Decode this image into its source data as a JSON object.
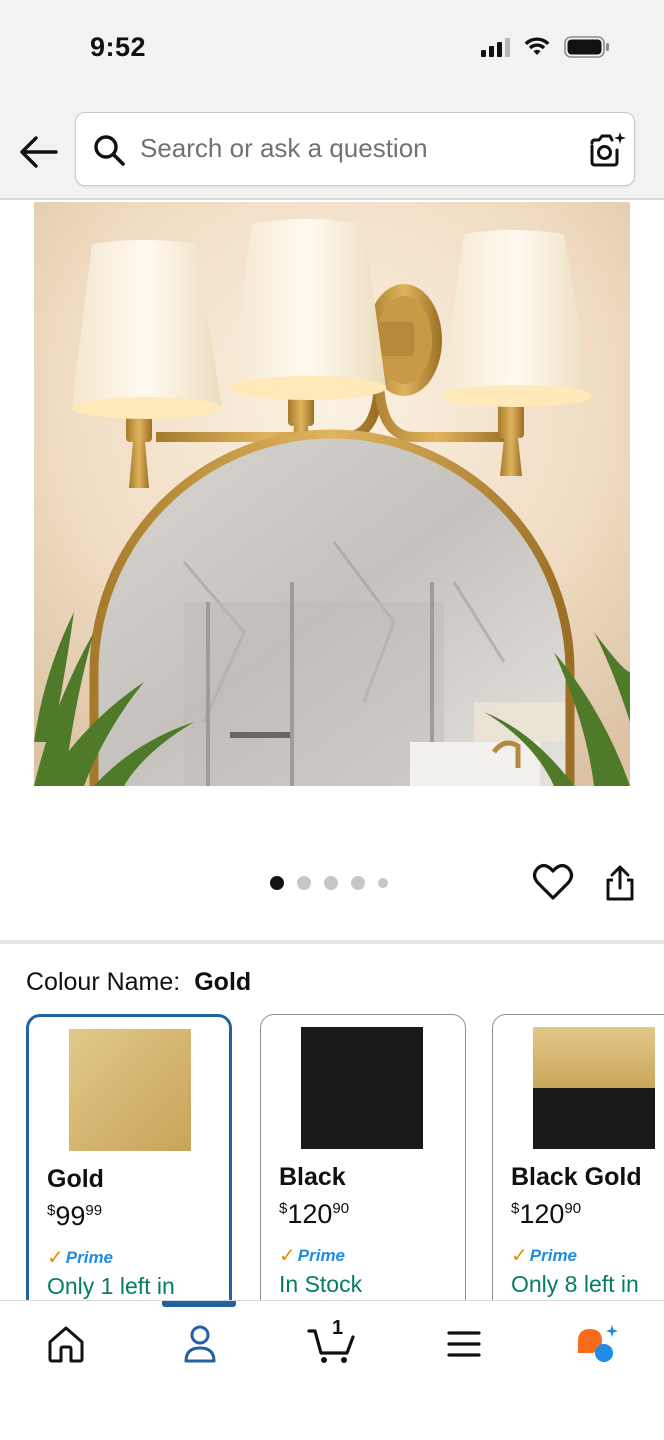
{
  "status_bar": {
    "time": "9:52"
  },
  "search": {
    "placeholder": "Search or ask a question"
  },
  "carousel": {
    "total_images": 5,
    "active_index": 0
  },
  "variation": {
    "label": "Colour Name:",
    "selected_value": "Gold",
    "options": [
      {
        "name": "Gold",
        "price_currency": "$",
        "price_whole": "99",
        "price_cents": "99",
        "prime_label": "Prime",
        "availability": "Only 1 left in",
        "swatch_colors": [
          "#d9bd79",
          "#c9a75a"
        ],
        "selected": true
      },
      {
        "name": "Black",
        "price_currency": "$",
        "price_whole": "120",
        "price_cents": "90",
        "prime_label": "Prime",
        "availability": "In Stock",
        "swatch_colors": [
          "#1a1a1a",
          "#1a1a1a"
        ],
        "selected": false
      },
      {
        "name": "Black Gold",
        "price_currency": "$",
        "price_whole": "120",
        "price_cents": "90",
        "prime_label": "Prime",
        "availability": "Only 8 left in",
        "swatch_colors": [
          "#d2b46a",
          "#1a1a1a"
        ],
        "selected": false
      }
    ]
  },
  "bottom_nav": {
    "items": [
      {
        "icon": "home-icon"
      },
      {
        "icon": "account-icon",
        "active": true
      },
      {
        "icon": "cart-icon",
        "badge": "1"
      },
      {
        "icon": "menu-icon"
      },
      {
        "icon": "rufus-assistant-icon"
      }
    ]
  },
  "colors": {
    "accent_blue": "#2162a1",
    "stock_green": "#067d62",
    "prime_blue": "#1f8ce6",
    "prime_check": "#f08804"
  }
}
